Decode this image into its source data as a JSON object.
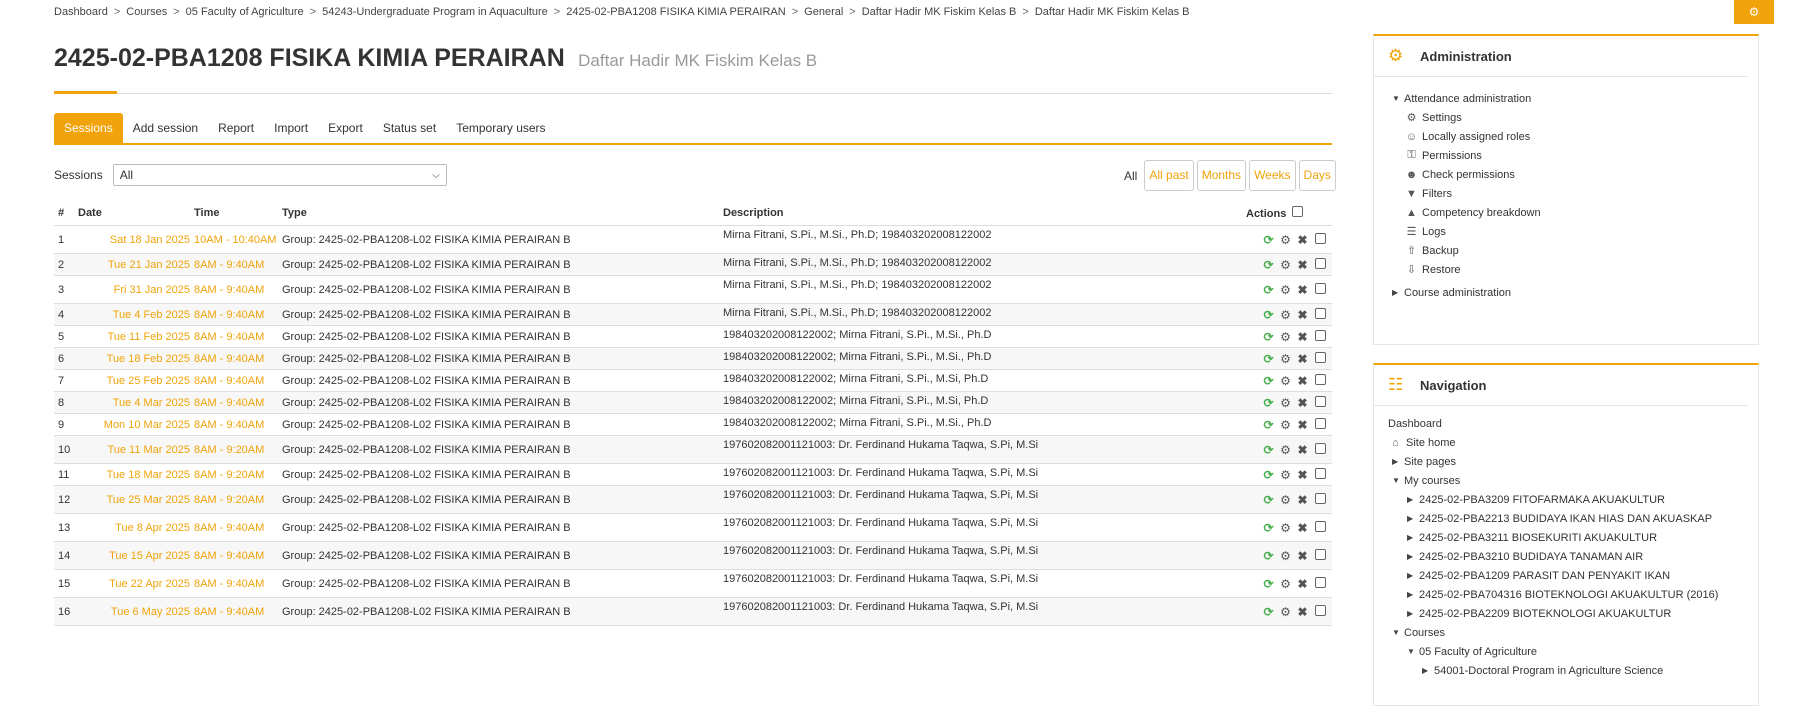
{
  "breadcrumb": [
    "Dashboard",
    "Courses",
    "05 Faculty of Agriculture",
    "54243-Undergraduate Program in Aquaculture",
    "2425-02-PBA1208 FISIKA KIMIA PERAIRAN",
    "General",
    "Daftar Hadir MK Fiskim Kelas B",
    "Daftar Hadir MK Fiskim Kelas B"
  ],
  "page": {
    "title": "2425-02-PBA1208 FISIKA KIMIA PERAIRAN",
    "subtitle": "Daftar Hadir MK Fiskim Kelas B"
  },
  "tabs": [
    "Sessions",
    "Add session",
    "Report",
    "Import",
    "Export",
    "Status set",
    "Temporary users"
  ],
  "filter": {
    "label": "Sessions",
    "selected": "All",
    "periods_label": "All",
    "periods": [
      "All past",
      "Months",
      "Weeks",
      "Days"
    ]
  },
  "table": {
    "headers": {
      "num": "#",
      "date": "Date",
      "time": "Time",
      "type": "Type",
      "desc": "Description",
      "actions": "Actions"
    },
    "rows": [
      {
        "num": "1",
        "date": "Sat 18 Jan 2025",
        "time": "10AM - 10:40AM",
        "type": "Group: 2425-02-PBA1208-L02 FISIKA KIMIA PERAIRAN B",
        "desc": "Mirna Fitrani, S.Pi., M.Si., Ph.D; 198403202008122002"
      },
      {
        "num": "2",
        "date": "Tue 21 Jan 2025",
        "time": "8AM - 9:40AM",
        "type": "Group: 2425-02-PBA1208-L02 FISIKA KIMIA PERAIRAN B",
        "desc": "Mirna Fitrani, S.Pi., M.Si., Ph.D; 198403202008122002"
      },
      {
        "num": "3",
        "date": "Fri 31 Jan 2025",
        "time": "8AM - 9:40AM",
        "type": "Group: 2425-02-PBA1208-L02 FISIKA KIMIA PERAIRAN B",
        "desc": "Mirna Fitrani, S.Pi., M.Si., Ph.D; 198403202008122002"
      },
      {
        "num": "4",
        "date": "Tue 4 Feb 2025",
        "time": "8AM - 9:40AM",
        "type": "Group: 2425-02-PBA1208-L02 FISIKA KIMIA PERAIRAN B",
        "desc": "Mirna Fitrani, S.Pi., M.Si., Ph.D; 198403202008122002"
      },
      {
        "num": "5",
        "date": "Tue 11 Feb 2025",
        "time": "8AM - 9:40AM",
        "type": "Group: 2425-02-PBA1208-L02 FISIKA KIMIA PERAIRAN B",
        "desc": "198403202008122002; Mirna Fitrani, S.Pi., M.Si., Ph.D"
      },
      {
        "num": "6",
        "date": "Tue 18 Feb 2025",
        "time": "8AM - 9:40AM",
        "type": "Group: 2425-02-PBA1208-L02 FISIKA KIMIA PERAIRAN B",
        "desc": "198403202008122002; Mirna Fitrani, S.Pi., M.Si., Ph.D"
      },
      {
        "num": "7",
        "date": "Tue 25 Feb 2025",
        "time": "8AM - 9:40AM",
        "type": "Group: 2425-02-PBA1208-L02 FISIKA KIMIA PERAIRAN B",
        "desc": "198403202008122002; Mirna Fitrani, S.Pi., M.Si, Ph.D"
      },
      {
        "num": "8",
        "date": "Tue 4 Mar 2025",
        "time": "8AM - 9:40AM",
        "type": "Group: 2425-02-PBA1208-L02 FISIKA KIMIA PERAIRAN B",
        "desc": "198403202008122002; Mirna Fitrani, S.Pi., M.Si, Ph.D"
      },
      {
        "num": "9",
        "date": "Mon 10 Mar 2025",
        "time": "8AM - 9:40AM",
        "type": "Group: 2425-02-PBA1208-L02 FISIKA KIMIA PERAIRAN B",
        "desc": "198403202008122002; Mirna Fitrani, S.Pi., M.Si., Ph.D"
      },
      {
        "num": "10",
        "date": "Tue 11 Mar 2025",
        "time": "8AM - 9:20AM",
        "type": "Group: 2425-02-PBA1208-L02 FISIKA KIMIA PERAIRAN B",
        "desc": "197602082001121003: Dr. Ferdinand Hukama Taqwa, S.Pi, M.Si"
      },
      {
        "num": "11",
        "date": "Tue 18 Mar 2025",
        "time": "8AM - 9:20AM",
        "type": "Group: 2425-02-PBA1208-L02 FISIKA KIMIA PERAIRAN B",
        "desc": "197602082001121003: Dr. Ferdinand Hukama Taqwa, S.Pi, M.Si"
      },
      {
        "num": "12",
        "date": "Tue 25 Mar 2025",
        "time": "8AM - 9:20AM",
        "type": "Group: 2425-02-PBA1208-L02 FISIKA KIMIA PERAIRAN B",
        "desc": "197602082001121003: Dr. Ferdinand Hukama Taqwa, S.Pi, M.Si"
      },
      {
        "num": "13",
        "date": "Tue 8 Apr 2025",
        "time": "8AM - 9:40AM",
        "type": "Group: 2425-02-PBA1208-L02 FISIKA KIMIA PERAIRAN B",
        "desc": "197602082001121003: Dr. Ferdinand Hukama Taqwa, S.Pi, M.Si"
      },
      {
        "num": "14",
        "date": "Tue 15 Apr 2025",
        "time": "8AM - 9:40AM",
        "type": "Group: 2425-02-PBA1208-L02 FISIKA KIMIA PERAIRAN B",
        "desc": "197602082001121003: Dr. Ferdinand Hukama Taqwa, S.Pi, M.Si"
      },
      {
        "num": "15",
        "date": "Tue 22 Apr 2025",
        "time": "8AM - 9:40AM",
        "type": "Group: 2425-02-PBA1208-L02 FISIKA KIMIA PERAIRAN B",
        "desc": "197602082001121003: Dr. Ferdinand Hukama Taqwa, S.Pi, M.Si"
      },
      {
        "num": "16",
        "date": "Tue 6 May 2025",
        "time": "8AM - 9:40AM",
        "type": "Group: 2425-02-PBA1208-L02 FISIKA KIMIA PERAIRAN B",
        "desc": "197602082001121003: Dr. Ferdinand Hukama Taqwa, S.Pi, M.Si"
      }
    ]
  },
  "admin": {
    "title": "Administration",
    "icon": "cogs-icon",
    "attendance": "Attendance administration",
    "items": [
      {
        "label": "Settings",
        "icon": "gear-icon"
      },
      {
        "label": "Locally assigned roles",
        "icon": "user-icon"
      },
      {
        "label": "Permissions",
        "icon": "key-icon"
      },
      {
        "label": "Check permissions",
        "icon": "user-check-icon"
      },
      {
        "label": "Filters",
        "icon": "filter-icon"
      },
      {
        "label": "Competency breakdown",
        "icon": "flask-icon"
      },
      {
        "label": "Logs",
        "icon": "list-icon"
      },
      {
        "label": "Backup",
        "icon": "upload-icon"
      },
      {
        "label": "Restore",
        "icon": "download-icon"
      }
    ],
    "course_admin": "Course administration"
  },
  "nav": {
    "title": "Navigation",
    "icon": "sitemap-icon",
    "dashboard": "Dashboard",
    "site_home": "Site home",
    "site_pages": "Site pages",
    "my_courses": "My courses",
    "courses_list": [
      "2425-02-PBA3209 FITOFARMAKA AKUAKULTUR",
      "2425-02-PBA2213 BUDIDAYA IKAN HIAS DAN AKUASKAP",
      "2425-02-PBA3211 BIOSEKURITI AKUAKULTUR",
      "2425-02-PBA3210 BUDIDAYA TANAMAN AIR",
      "2425-02-PBA1209 PARASIT DAN PENYAKIT IKAN",
      "2425-02-PBA704316 BIOTEKNOLOGI AKUAKULTUR (2016)",
      "2425-02-PBA2209 BIOTEKNOLOGI AKUAKULTUR"
    ],
    "courses": "Courses",
    "faculty": "05 Faculty of Agriculture",
    "program": "54001-Doctoral Program in Agriculture Science"
  },
  "colors": {
    "accent": "#f0a30a",
    "redo": "#4caf50"
  }
}
